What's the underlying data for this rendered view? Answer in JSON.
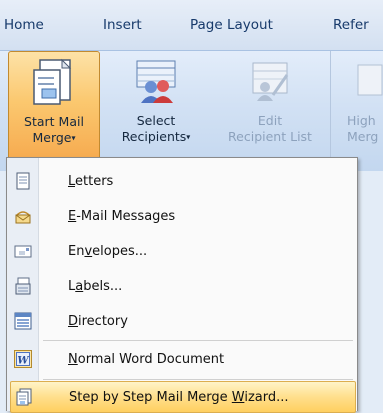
{
  "ribbon_tabs": [
    "Home",
    "Insert",
    "Page Layout",
    "Refer"
  ],
  "ribbon": {
    "start_mail_merge": [
      "Start Mail",
      "Merge"
    ],
    "select_recipients": [
      "Select",
      "Recipients"
    ],
    "edit_recipient_list": [
      "Edit",
      "Recipient List"
    ],
    "highlight_partial": [
      "High",
      "Merg"
    ],
    "dropdown_glyph": "▾"
  },
  "menu": {
    "items": [
      {
        "mnemonic": "L",
        "rest": "etters",
        "icon": "letter-icon"
      },
      {
        "mnemonic": "E",
        "rest": "-Mail Messages",
        "icon": "email-icon"
      },
      {
        "pre": "En",
        "mnemonic": "v",
        "rest": "elopes...",
        "icon": "envelope-icon"
      },
      {
        "pre": "L",
        "mnemonic": "a",
        "rest": "bels...",
        "icon": "labels-icon"
      },
      {
        "mnemonic": "D",
        "rest": "irectory",
        "icon": "directory-icon"
      },
      {
        "mnemonic": "N",
        "rest": "ormal Word Document",
        "icon": "word-document-icon"
      },
      {
        "pre": "Step by Step Mail Merge ",
        "mnemonic": "W",
        "rest": "izard...",
        "icon": "wizard-icon"
      }
    ],
    "highlighted_index": 6
  },
  "colors": {
    "highlight_top": "#fff4c8",
    "highlight_bottom": "#ffd060",
    "active_button_border": "#c28a30"
  }
}
